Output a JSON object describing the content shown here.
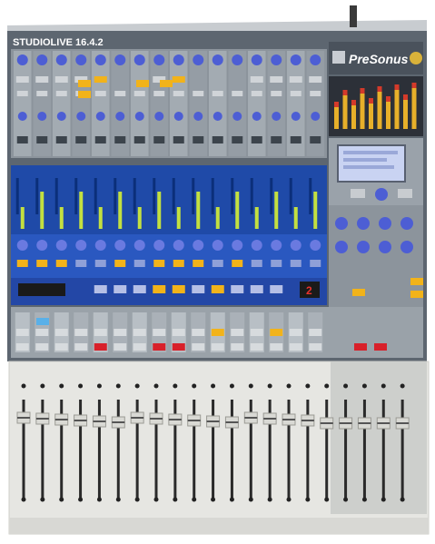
{
  "photo": {
    "subject": "digital mixing console",
    "model_label": "STUDIOLIVE 16.4.2",
    "brand_label": "PreSonus",
    "channel_count": 16,
    "sub_fader_count": 5,
    "lcd_readout": "2",
    "colors": {
      "console_body": "#5d6670",
      "strip_panel": "#9aa2a9",
      "meter_bridge": "#1f4aa8",
      "knob_blue": "#4d5ed4",
      "button_yellow": "#f2b31a",
      "button_red": "#d8202a",
      "fader_bed": "#e6e6e2",
      "lcd": "#c9d3f2"
    }
  }
}
